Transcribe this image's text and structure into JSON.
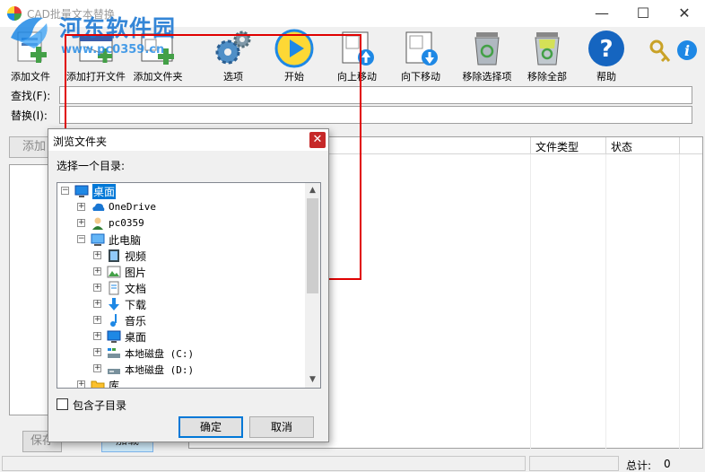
{
  "window": {
    "title": "CAD批量文本替换"
  },
  "watermark": {
    "site_name": "河东软件园",
    "url": "www.pc0359.cn"
  },
  "toolbar": {
    "add_file": "添加文件",
    "add_open_file": "添加打开文件",
    "add_folder": "添加文件夹",
    "options": "选项",
    "start": "开始",
    "move_up": "向上移动",
    "move_down": "向下移动",
    "remove_selected": "移除选择项",
    "remove_all": "移除全部",
    "help": "帮助"
  },
  "fields": {
    "find_label": "查找(F):",
    "find_value": "",
    "replace_label": "替换(I):",
    "replace_value": ""
  },
  "main": {
    "add_button": "添加",
    "save_button": "保存",
    "load_button": "加载",
    "columns": {
      "file_type": "文件类型",
      "status": "状态"
    }
  },
  "status": {
    "total_label": "总计:",
    "total_value": "0"
  },
  "dialog": {
    "title": "浏览文件夹",
    "prompt": "选择一个目录:",
    "tree": [
      {
        "label": "桌面",
        "level": 0,
        "expander": "−",
        "icon": "desktop-icon",
        "selected": true
      },
      {
        "label": "OneDrive",
        "level": 1,
        "expander": "+",
        "icon": "cloud-icon",
        "mono": true
      },
      {
        "label": "pc0359",
        "level": 1,
        "expander": "+",
        "icon": "user-icon",
        "mono": true
      },
      {
        "label": "此电脑",
        "level": 1,
        "expander": "−",
        "icon": "computer-icon"
      },
      {
        "label": "视频",
        "level": 2,
        "expander": "+",
        "icon": "video-icon"
      },
      {
        "label": "图片",
        "level": 2,
        "expander": "+",
        "icon": "pictures-icon"
      },
      {
        "label": "文档",
        "level": 2,
        "expander": "+",
        "icon": "documents-icon"
      },
      {
        "label": "下载",
        "level": 2,
        "expander": "+",
        "icon": "download-icon"
      },
      {
        "label": "音乐",
        "level": 2,
        "expander": "+",
        "icon": "music-icon"
      },
      {
        "label": "桌面",
        "level": 2,
        "expander": "+",
        "icon": "desktop-icon"
      },
      {
        "label": "本地磁盘 (C:)",
        "level": 2,
        "expander": "+",
        "icon": "disk-c-icon",
        "mono": true
      },
      {
        "label": "本地磁盘 (D:)",
        "level": 2,
        "expander": "+",
        "icon": "disk-icon",
        "mono": true
      },
      {
        "label": "库",
        "level": 1,
        "expander": "+",
        "icon": "library-icon"
      }
    ],
    "include_subdirs": "包含子目录",
    "include_subdirs_checked": false,
    "ok": "确定",
    "cancel": "取消"
  }
}
